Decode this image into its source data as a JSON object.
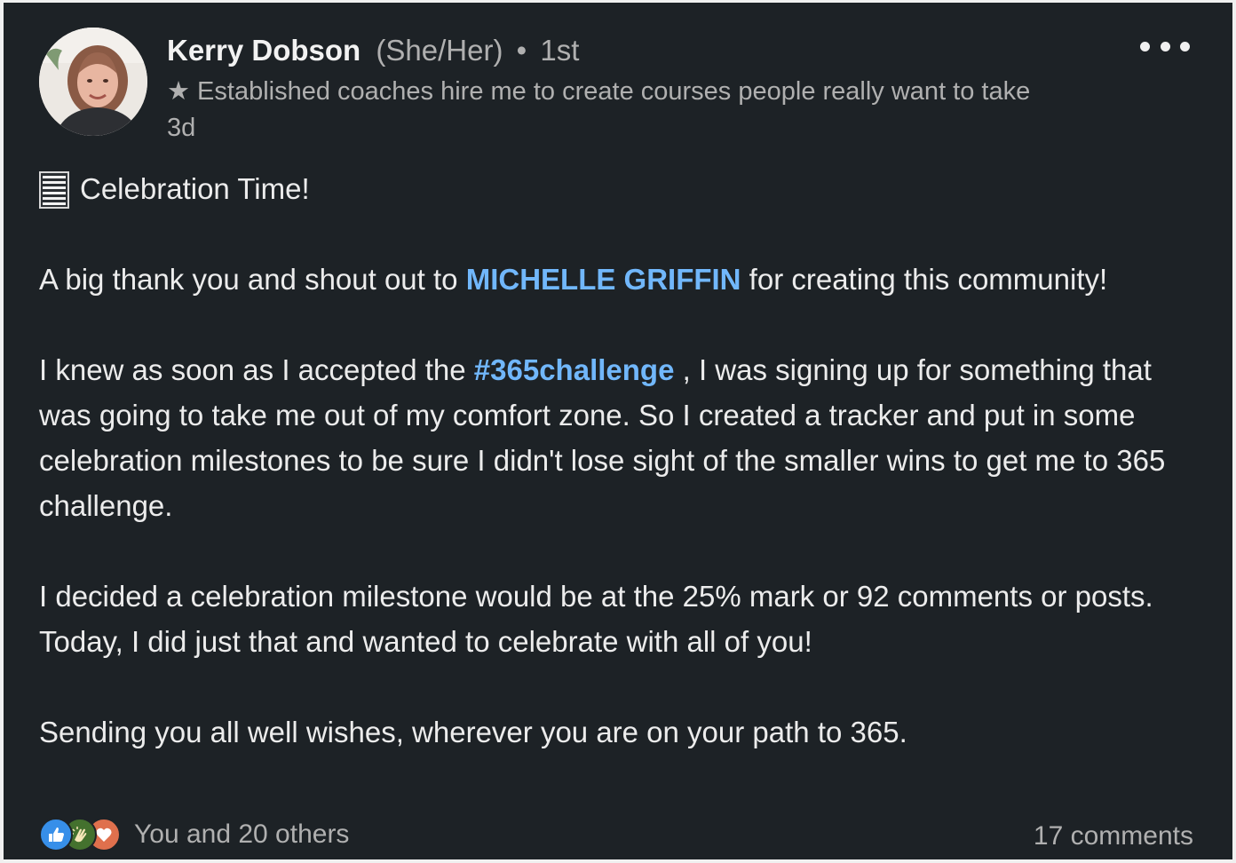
{
  "author": {
    "name": "Kerry Dobson",
    "pronouns": "(She/Her)",
    "bullet": "•",
    "connection_degree": "1st",
    "headline": "★ Established coaches hire me to create courses people really want to take",
    "time_ago": "3d"
  },
  "post": {
    "line1": "Celebration Time!",
    "para1_before": "A big thank you and shout out to ",
    "para1_mention": "MICHELLE GRIFFIN",
    "para1_after": " for creating this community!",
    "para2_before": "I knew as soon as I accepted the ",
    "para2_hashtag": "#365challenge",
    "para2_after": " , I was signing up for something that was going to take me out of my comfort zone. So I created a tracker and put in some celebration milestones to be sure I didn't lose sight of the smaller wins to get me to 365 challenge.",
    "para3": "I decided a celebration milestone would be at the 25% mark or 92 comments or posts. Today, I did just that and wanted to celebrate with all of you!",
    "para4": "Sending you all well wishes, wherever you are on your path to 365."
  },
  "footer": {
    "reactions_text": "You and 20 others",
    "comments_text": "17 comments"
  },
  "icons": {
    "more": "more-horizontal-icon",
    "list": "list-icon",
    "like": "like-reaction-icon",
    "clap": "celebrate-reaction-icon",
    "love": "love-reaction-icon"
  },
  "colors": {
    "background": "#1d2226",
    "link": "#71b7fb",
    "muted": "#b0b0b0",
    "like": "#378fe9",
    "celebrate": "#44712e",
    "love": "#df704d"
  }
}
